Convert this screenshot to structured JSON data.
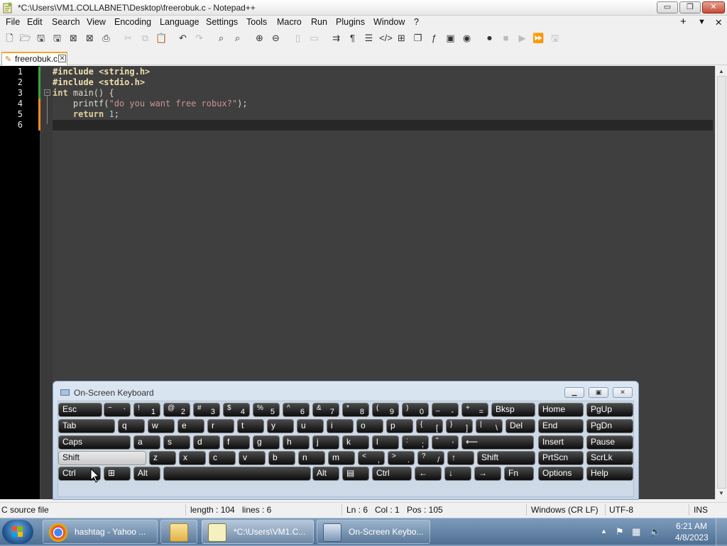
{
  "window": {
    "title": "*C:\\Users\\VM1.COLLABNET\\Desktop\\freerobuk.c - Notepad++",
    "controls": {
      "minimize": "▭",
      "maximize": "❐",
      "close": "✕"
    }
  },
  "menubar": {
    "items": [
      "File",
      "Edit",
      "Search",
      "View",
      "Encoding",
      "Language",
      "Settings",
      "Tools",
      "Macro",
      "Run",
      "Plugins",
      "Window",
      "?"
    ],
    "right": {
      "add": "+",
      "dropdown": "▼",
      "close": "✕"
    }
  },
  "tab": {
    "label": "freerobuk.c"
  },
  "editor": {
    "line_numbers": [
      "1",
      "2",
      "3",
      "4",
      "5",
      "6"
    ],
    "lines": [
      {
        "parts": [
          {
            "c": "pp",
            "t": "#include <string.h>"
          }
        ]
      },
      {
        "parts": [
          {
            "c": "pp",
            "t": "#include <stdio.h>"
          }
        ]
      },
      {
        "parts": [
          {
            "c": "kw",
            "t": "int"
          },
          {
            "c": "tx",
            "t": " main() {"
          }
        ]
      },
      {
        "parts": [
          {
            "c": "tx",
            "t": "    printf("
          },
          {
            "c": "st",
            "t": "\"do you want free robux?\""
          },
          {
            "c": "tx",
            "t": ");"
          }
        ]
      },
      {
        "parts": [
          {
            "c": "kw",
            "t": "    return"
          },
          {
            "c": "tx",
            "t": " "
          },
          {
            "c": "nm",
            "t": "1"
          },
          {
            "c": "tx",
            "t": ";"
          }
        ]
      },
      {
        "parts": []
      }
    ]
  },
  "status": {
    "file_type": "C source file",
    "length": "length : 104",
    "lines": "lines : 6",
    "ln": "Ln : 6",
    "col": "Col : 1",
    "pos": "Pos : 105",
    "eol": "Windows (CR LF)",
    "encoding": "UTF-8",
    "mode": "INS"
  },
  "osk": {
    "title": "On-Screen Keyboard",
    "rows": [
      [
        {
          "l": "Esc"
        },
        {
          "t": "~",
          "b": "`"
        },
        {
          "t": "!",
          "b": "1"
        },
        {
          "t": "@",
          "b": "2"
        },
        {
          "t": "#",
          "b": "3"
        },
        {
          "t": "$",
          "b": "4"
        },
        {
          "t": "%",
          "b": "5"
        },
        {
          "t": "^",
          "b": "6"
        },
        {
          "t": "&",
          "b": "7"
        },
        {
          "t": "*",
          "b": "8"
        },
        {
          "t": "(",
          "b": "9"
        },
        {
          "t": ")",
          "b": "0"
        },
        {
          "t": "_",
          "b": "-"
        },
        {
          "t": "+",
          "b": "="
        },
        {
          "l": "Bksp"
        },
        {
          "l": "Home"
        },
        {
          "l": "PgUp"
        }
      ],
      [
        {
          "l": "Tab"
        },
        {
          "l": "q"
        },
        {
          "l": "w"
        },
        {
          "l": "e"
        },
        {
          "l": "r"
        },
        {
          "l": "t"
        },
        {
          "l": "y"
        },
        {
          "l": "u"
        },
        {
          "l": "i"
        },
        {
          "l": "o"
        },
        {
          "l": "p"
        },
        {
          "t": "{",
          "b": "["
        },
        {
          "t": "}",
          "b": "]"
        },
        {
          "t": "|",
          "b": "\\"
        },
        {
          "l": "Del"
        },
        {
          "l": "End"
        },
        {
          "l": "PgDn"
        }
      ],
      [
        {
          "l": "Caps"
        },
        {
          "l": "a"
        },
        {
          "l": "s"
        },
        {
          "l": "d"
        },
        {
          "l": "f"
        },
        {
          "l": "g"
        },
        {
          "l": "h"
        },
        {
          "l": "j"
        },
        {
          "l": "k"
        },
        {
          "l": "l"
        },
        {
          "t": ":",
          "b": ";"
        },
        {
          "t": "\"",
          "b": "'"
        },
        {
          "l": "⟵"
        },
        {
          "l": "Insert"
        },
        {
          "l": "Pause"
        }
      ],
      [
        {
          "l": "Shift",
          "hl": true
        },
        {
          "l": "z"
        },
        {
          "l": "x"
        },
        {
          "l": "c"
        },
        {
          "l": "v"
        },
        {
          "l": "b"
        },
        {
          "l": "n"
        },
        {
          "l": "m"
        },
        {
          "t": "<",
          "b": ","
        },
        {
          "t": ">",
          "b": "."
        },
        {
          "t": "?",
          "b": "/"
        },
        {
          "l": "↑"
        },
        {
          "l": "Shift"
        },
        {
          "l": "PrtScn"
        },
        {
          "l": "ScrLk"
        }
      ],
      [
        {
          "l": "Ctrl"
        },
        {
          "l": "⊞"
        },
        {
          "l": "Alt"
        },
        {
          "l": ""
        },
        {
          "l": "Alt"
        },
        {
          "l": "▤"
        },
        {
          "l": "Ctrl"
        },
        {
          "l": "←"
        },
        {
          "l": "↓"
        },
        {
          "l": "→"
        },
        {
          "l": "Fn"
        },
        {
          "l": "Options"
        },
        {
          "l": "Help"
        }
      ]
    ]
  },
  "taskbar": {
    "items": [
      {
        "label": "hashtag - Yahoo ...",
        "icon": "chrome-icon"
      },
      {
        "label": "",
        "icon": "folder-icon"
      },
      {
        "label": "*C:\\Users\\VM1.C...",
        "icon": "notepadpp-icon"
      },
      {
        "label": "On-Screen Keybo...",
        "icon": "keyboard-icon"
      }
    ],
    "time": "6:21 AM",
    "date": "4/8/2023"
  }
}
